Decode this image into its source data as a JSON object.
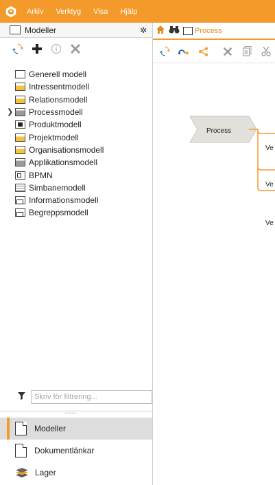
{
  "menubar": {
    "logo_icon": "app-logo-icon",
    "items": [
      "Arkiv",
      "Verktyg",
      "Visa",
      "Hjälp"
    ]
  },
  "left_panel": {
    "header": {
      "title": "Modeller",
      "icon": "document-icon",
      "settings_icon": "gear-icon"
    },
    "toolbar": [
      {
        "name": "refresh-icon"
      },
      {
        "name": "add-icon"
      },
      {
        "name": "info-icon"
      },
      {
        "name": "delete-icon"
      }
    ],
    "tree": [
      {
        "label": "Generell modell",
        "icon": "doc"
      },
      {
        "label": "Intressentmodell",
        "icon": "yellow"
      },
      {
        "label": "Relationsmodell",
        "icon": "yellow"
      },
      {
        "label": "Processmodell",
        "icon": "gray",
        "expandable": true
      },
      {
        "label": "Produktmodell",
        "icon": "black"
      },
      {
        "label": "Projektmodell",
        "icon": "yellow"
      },
      {
        "label": "Organisationsmodell",
        "icon": "yellow"
      },
      {
        "label": "Applikationsmodell",
        "icon": "gray"
      },
      {
        "label": "BPMN",
        "icon": "bpmn"
      },
      {
        "label": "Simbanemodell",
        "icon": "lines"
      },
      {
        "label": "Informationsmodell",
        "icon": "info"
      },
      {
        "label": "Begreppsmodell",
        "icon": "info"
      }
    ],
    "filter": {
      "placeholder": "Skriv för filtrering...",
      "value": ""
    },
    "bottom_tabs": [
      {
        "label": "Modeller",
        "active": true
      },
      {
        "label": "Dokumentlänkar",
        "active": false
      },
      {
        "label": "Lager",
        "active": false
      }
    ]
  },
  "right_panel": {
    "tab": {
      "label": "Process"
    },
    "canvas": {
      "process_label": "Process",
      "row_labels": [
        "Ve",
        "Ve",
        "Ve"
      ]
    }
  },
  "colors": {
    "accent": "#f39a2b",
    "yellow": "#f7c23b"
  }
}
